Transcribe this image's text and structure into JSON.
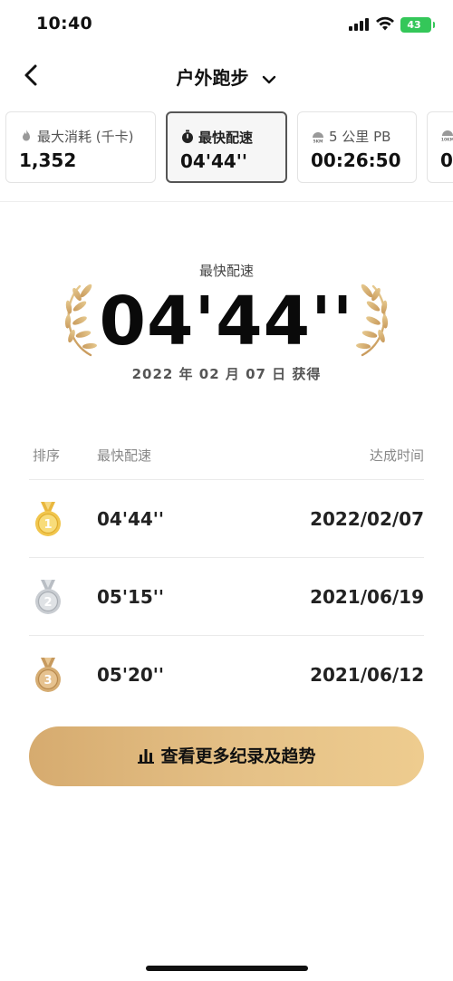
{
  "status_bar": {
    "time": "10:40",
    "battery": "43"
  },
  "nav": {
    "title": "户外跑步"
  },
  "cards": [
    {
      "label": "最大消耗 (千卡)",
      "value": "1,352",
      "icon": "flame-icon"
    },
    {
      "label": "最快配速",
      "value": "04'44''",
      "icon": "stopwatch-icon",
      "selected": true
    },
    {
      "label": "5 公里 PB",
      "value": "00:26:50",
      "icon": "5km-badge-icon"
    },
    {
      "label": "",
      "value": "0",
      "icon": "10km-badge-icon"
    }
  ],
  "hero": {
    "label": "最快配速",
    "value": "04'44''",
    "date": "2022 年 02 月 07 日 获得"
  },
  "table": {
    "headers": {
      "rank": "排序",
      "pace": "最快配速",
      "time": "达成时间"
    },
    "rows": [
      {
        "rank": "1",
        "pace": "04'44''",
        "date": "2022/02/07",
        "medal": "gold"
      },
      {
        "rank": "2",
        "pace": "05'15''",
        "date": "2021/06/19",
        "medal": "silver"
      },
      {
        "rank": "3",
        "pace": "05'20''",
        "date": "2021/06/12",
        "medal": "bronze"
      }
    ]
  },
  "cta": {
    "label": "查看更多纪录及趋势"
  },
  "colors": {
    "gold": "#e8b93a",
    "accent": "#d9ae70",
    "text": "#111111"
  }
}
